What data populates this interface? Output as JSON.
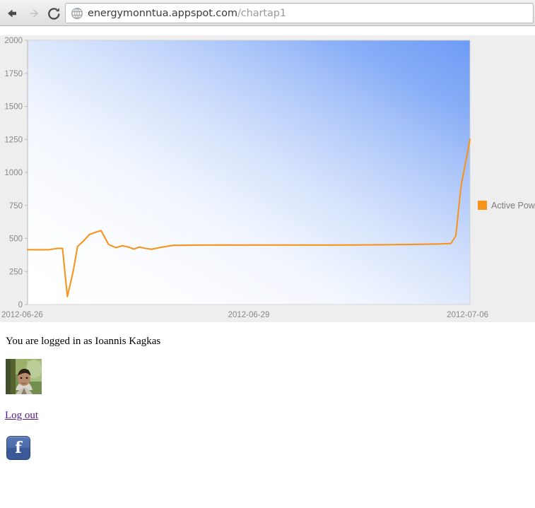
{
  "browser": {
    "back_icon": "back-arrow-icon",
    "forward_icon": "forward-arrow-icon",
    "reload_icon": "reload-icon",
    "favicon": "globe-icon",
    "url_domain": "energymonntua.appspot.com",
    "url_path": "/chartap1",
    "url_full": "energymonntua.appspot.com/chartap1"
  },
  "page": {
    "login_status": "You are logged in as Ioannis Kagkas",
    "logout_label": "Log out",
    "avatar_alt": "avatar",
    "facebook_glyph": "f"
  },
  "colors": {
    "series": "#F7941E",
    "plot_gradient_from": "#ffffff",
    "plot_gradient_to": "#6D9BF5",
    "chart_background": "#eeeeee",
    "axis_text": "#888888",
    "link": "#551a8b",
    "facebook": "#3b5998"
  },
  "chart_data": {
    "type": "line",
    "title": "",
    "xlabel": "",
    "ylabel": "",
    "grid": false,
    "legend_position": "right",
    "ylim": [
      0,
      2000
    ],
    "ytick_labels": [
      "0",
      "250",
      "500",
      "750",
      "1000",
      "1250",
      "1500",
      "1750",
      "2000"
    ],
    "ytick_values": [
      0,
      250,
      500,
      750,
      1000,
      1250,
      1500,
      1750,
      2000
    ],
    "xtick_labels": [
      "2012-06-26",
      "2012-06-29",
      "2012-07-06"
    ],
    "xtick_positions": [
      0,
      0.5,
      1.0
    ],
    "series": [
      {
        "name": "Active Power",
        "color": "#F7941E",
        "x": [
          0.0,
          0.048,
          0.068,
          0.079,
          0.09,
          0.103,
          0.113,
          0.126,
          0.14,
          0.152,
          0.166,
          0.183,
          0.2,
          0.214,
          0.228,
          0.24,
          0.253,
          0.266,
          0.28,
          0.3,
          0.33,
          0.4,
          0.5,
          0.6,
          0.7,
          0.8,
          0.87,
          0.93,
          0.957,
          0.968,
          0.98,
          1.0
        ],
        "y": [
          415,
          415,
          425,
          425,
          60,
          250,
          440,
          480,
          530,
          545,
          560,
          455,
          430,
          445,
          435,
          420,
          435,
          425,
          418,
          432,
          448,
          450,
          450,
          450,
          450,
          452,
          455,
          458,
          462,
          520,
          900,
          1250
        ]
      }
    ],
    "legend": [
      {
        "label": "Active Power",
        "color": "#F7941E",
        "marker": "square"
      }
    ]
  }
}
